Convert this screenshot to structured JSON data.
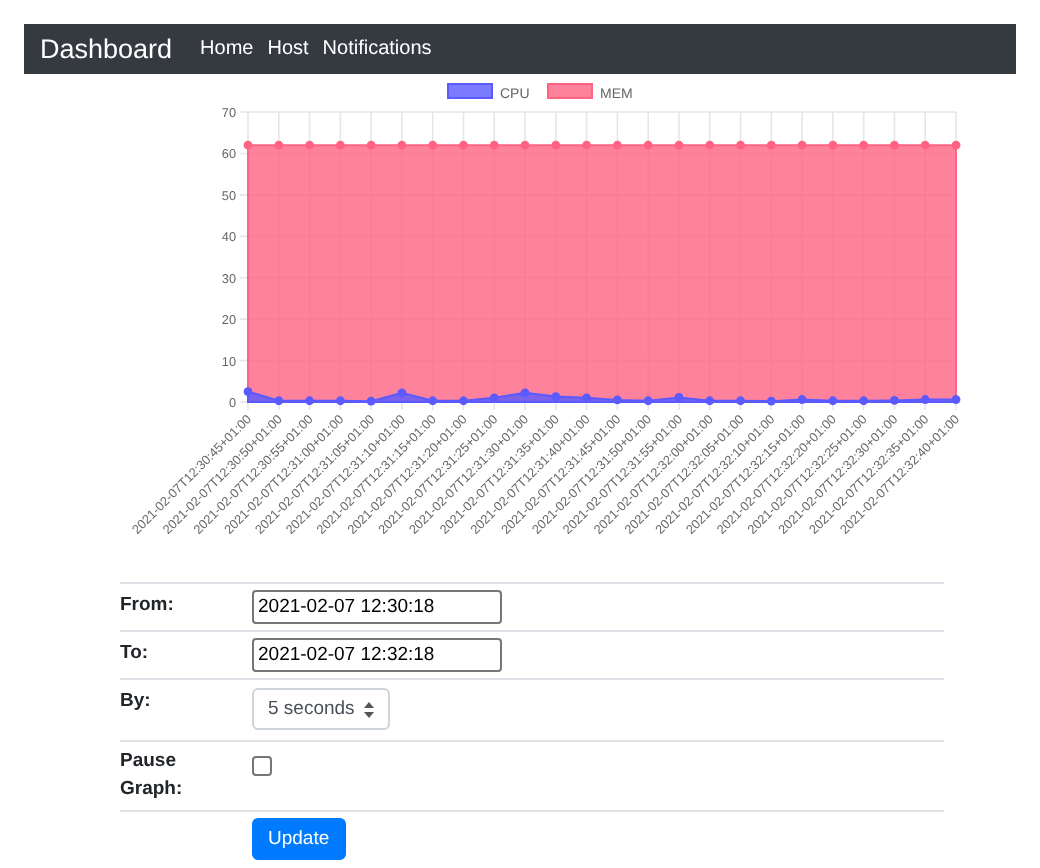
{
  "navbar": {
    "brand": "Dashboard",
    "links": [
      "Home",
      "Host",
      "Notifications"
    ]
  },
  "chart_data": {
    "type": "area",
    "x": [
      "2021-02-07T12:30:45+01:00",
      "2021-02-07T12:30:50+01:00",
      "2021-02-07T12:30:55+01:00",
      "2021-02-07T12:31:00+01:00",
      "2021-02-07T12:31:05+01:00",
      "2021-02-07T12:31:10+01:00",
      "2021-02-07T12:31:15+01:00",
      "2021-02-07T12:31:20+01:00",
      "2021-02-07T12:31:25+01:00",
      "2021-02-07T12:31:30+01:00",
      "2021-02-07T12:31:35+01:00",
      "2021-02-07T12:31:40+01:00",
      "2021-02-07T12:31:45+01:00",
      "2021-02-07T12:31:50+01:00",
      "2021-02-07T12:31:55+01:00",
      "2021-02-07T12:32:00+01:00",
      "2021-02-07T12:32:05+01:00",
      "2021-02-07T12:32:10+01:00",
      "2021-02-07T12:32:15+01:00",
      "2021-02-07T12:32:20+01:00",
      "2021-02-07T12:32:25+01:00",
      "2021-02-07T12:32:30+01:00",
      "2021-02-07T12:32:35+01:00",
      "2021-02-07T12:32:40+01:00"
    ],
    "series": [
      {
        "name": "CPU",
        "color": "#5a5aff",
        "values": [
          2.5,
          0.3,
          0.3,
          0.3,
          0.2,
          2.2,
          0.3,
          0.3,
          1,
          2.2,
          1.3,
          1,
          0.5,
          0.3,
          1.1,
          0.3,
          0.3,
          0.2,
          0.6,
          0.3,
          0.3,
          0.4,
          0.6,
          0.6
        ]
      },
      {
        "name": "MEM",
        "color": "#ff6384",
        "values": [
          62,
          62,
          62,
          62,
          62,
          62,
          62,
          62,
          62,
          62,
          62,
          62,
          62,
          62,
          62,
          62,
          62,
          62,
          62,
          62,
          62,
          62,
          62,
          62
        ]
      }
    ],
    "grid": true,
    "legend": true,
    "ylim": [
      0,
      70
    ],
    "yticks": [
      0,
      10,
      20,
      30,
      40,
      50,
      60,
      70
    ]
  },
  "form": {
    "from_label": "From:",
    "from_value": "2021-02-07 12:30:18",
    "to_label": "To:",
    "to_value": "2021-02-07 12:32:18",
    "by_label": "By:",
    "by_value": "5 seconds",
    "pause_label": "Pause Graph:",
    "pause_checked": false,
    "button": "Update"
  }
}
